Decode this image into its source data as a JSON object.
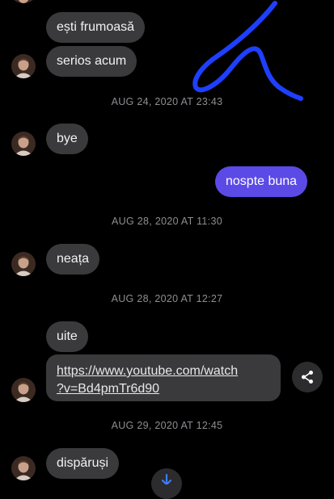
{
  "messages": [
    {
      "text": "ești frumoasă"
    },
    {
      "text": "serios acum"
    },
    {
      "text": "bye"
    },
    {
      "text": "nospte buna"
    },
    {
      "text": "neața"
    },
    {
      "text": "uite"
    },
    {
      "text": "dispăruși"
    }
  ],
  "link_message": {
    "line1": "https://www.youtube.com/watch",
    "line2": "?v=Bd4pmTr6d90"
  },
  "timestamps": [
    "AUG 24, 2020 AT 23:43",
    "AUG 28, 2020 AT 11:30",
    "AUG 28, 2020 AT 12:27",
    "AUG 29, 2020 AT 12:45"
  ],
  "colors": {
    "incoming_bubble": "#3a3a3c",
    "outgoing_bubble": "#5b4ae6",
    "timestamp_text": "#8e8e93",
    "scribble": "#1f3fff",
    "background": "#000000"
  },
  "icons": {
    "share": "share-icon",
    "scroll": "arrow-down-icon"
  }
}
